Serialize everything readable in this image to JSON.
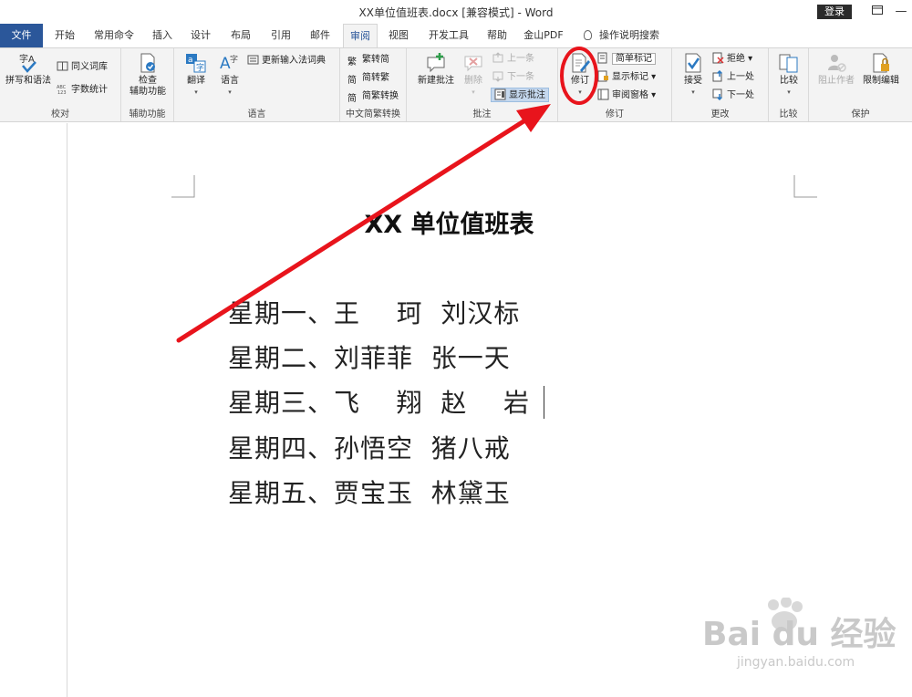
{
  "window": {
    "title": "XX单位值班表.docx [兼容模式]  -  Word",
    "login_label": "登录",
    "restore_icon": "ribbon-display-icon",
    "minimize_label": "—"
  },
  "tabs": [
    "文件",
    "开始",
    "常用命令",
    "插入",
    "设计",
    "布局",
    "引用",
    "邮件",
    "审阅",
    "视图",
    "开发工具",
    "帮助",
    "金山PDF"
  ],
  "active_tab": "审阅",
  "search_hint": "操作说明搜索",
  "ribbon": {
    "proofing": {
      "label": "校对",
      "spelling": "拼写和语法",
      "thesaurus": "同义词库",
      "wordcount": "字数统计"
    },
    "accessibility": {
      "label": "辅助功能",
      "check_line1": "检查",
      "check_line2": "辅助功能"
    },
    "language": {
      "label": "语言",
      "translate": "翻译",
      "language": "语言",
      "ime": "更新输入法词典"
    },
    "chinese_conversion": {
      "label": "中文简繁转换",
      "to_simplified": "繁转简",
      "to_traditional": "简转繁",
      "convert": "简繁转换"
    },
    "comments": {
      "label": "批注",
      "new": "新建批注",
      "delete": "删除",
      "prev": "上一条",
      "next": "下一条",
      "show": "显示批注"
    },
    "tracking": {
      "label": "修订",
      "track": "修订",
      "simple_markup": "简单标记",
      "show_markup": "显示标记",
      "review_pane": "审阅窗格"
    },
    "changes": {
      "label": "更改",
      "accept": "接受",
      "reject": "拒绝",
      "previous": "上一处",
      "next": "下一处"
    },
    "compare": {
      "label": "比较",
      "compare": "比较"
    },
    "protect": {
      "label": "保护",
      "block_authors": "阻止作者",
      "restrict": "限制编辑"
    }
  },
  "document": {
    "title": "XX 单位值班表",
    "lines": [
      "星期一、王    珂  刘汉标",
      "星期二、刘菲菲  张一天",
      "星期三、飞    翔  赵    岩",
      "星期四、孙悟空  猪八戒",
      "星期五、贾宝玉  林黛玉"
    ]
  },
  "watermark": {
    "brand": "Bai du 经验",
    "url": "jingyan.baidu.com"
  },
  "annotation": {
    "color": "#e8141c"
  }
}
